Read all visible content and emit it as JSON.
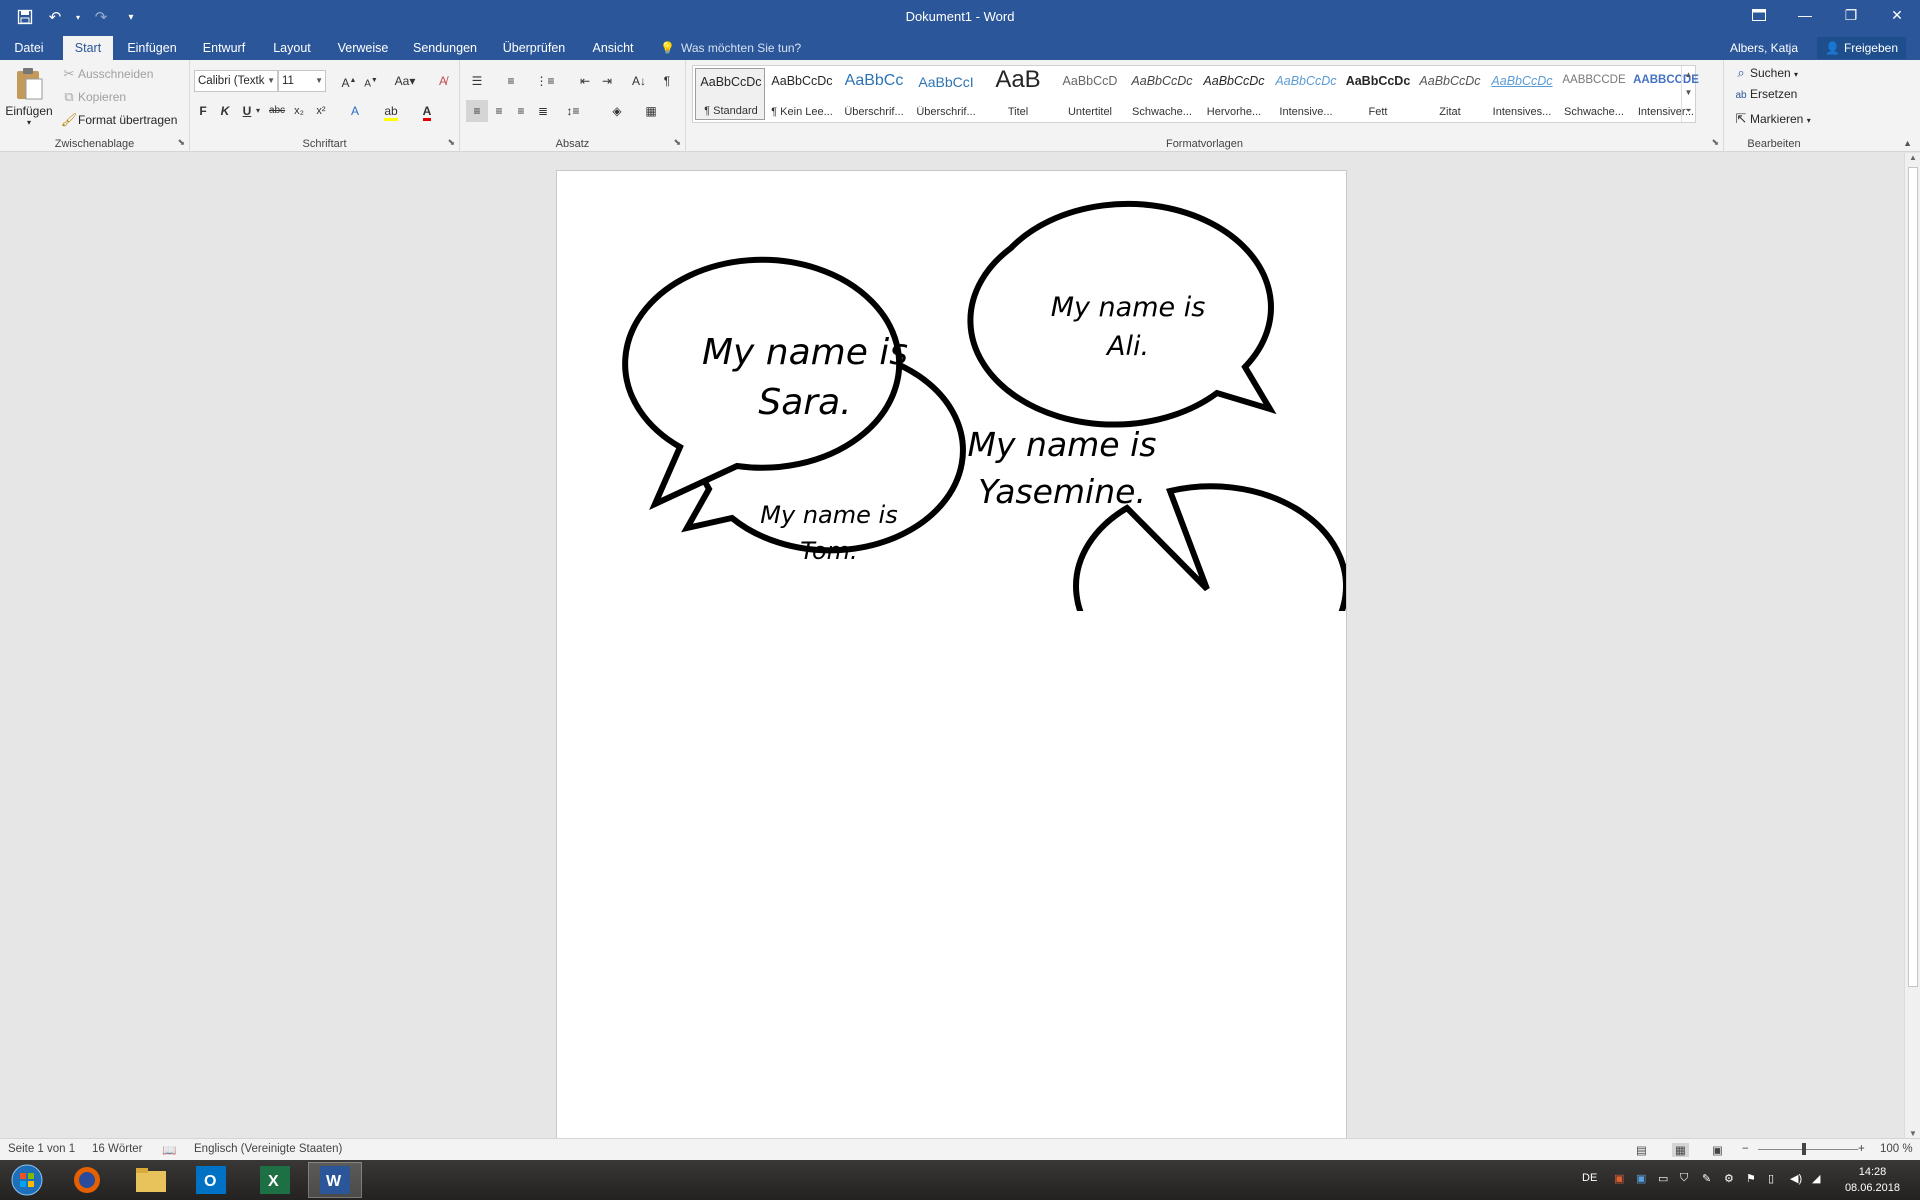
{
  "window": {
    "title": "Dokument1 - Word",
    "quick_access": [
      "save-icon",
      "undo-icon",
      "redo-icon",
      "customize-icon"
    ]
  },
  "tabs": [
    {
      "label": "Datei"
    },
    {
      "label": "Start"
    },
    {
      "label": "Einfügen"
    },
    {
      "label": "Entwurf"
    },
    {
      "label": "Layout"
    },
    {
      "label": "Verweise"
    },
    {
      "label": "Sendungen"
    },
    {
      "label": "Überprüfen"
    },
    {
      "label": "Ansicht"
    }
  ],
  "active_tab": "Start",
  "tell_me": "Was möchten Sie tun?",
  "user": "Albers, Katja",
  "share": "Freigeben",
  "clipboard": {
    "paste": "Einfügen",
    "cut": "Ausschneiden",
    "copy": "Kopieren",
    "format_painter": "Format übertragen",
    "label": "Zwischenablage"
  },
  "font": {
    "family": "Calibri (Textk",
    "size": "11",
    "bold": "F",
    "italic": "K",
    "underline": "U",
    "label": "Schriftart"
  },
  "paragraph": {
    "label": "Absatz"
  },
  "styles": {
    "label": "Formatvorlagen",
    "items": [
      {
        "sample": "AaBbCcDc",
        "name": "¶ Standard"
      },
      {
        "sample": "AaBbCcDc",
        "name": "¶ Kein Lee..."
      },
      {
        "sample": "AaBbCc",
        "name": "Überschrif..."
      },
      {
        "sample": "AaBbCcI",
        "name": "Überschrif..."
      },
      {
        "sample": "AaB",
        "name": "Titel"
      },
      {
        "sample": "AaBbCcD",
        "name": "Untertitel"
      },
      {
        "sample": "AaBbCcDc",
        "name": "Schwache..."
      },
      {
        "sample": "AaBbCcDc",
        "name": "Hervorhe..."
      },
      {
        "sample": "AaBbCcDc",
        "name": "Intensive..."
      },
      {
        "sample": "AaBbCcDc",
        "name": "Fett"
      },
      {
        "sample": "AaBbCcDc",
        "name": "Zitat"
      },
      {
        "sample": "AaBbCcDc",
        "name": "Intensives..."
      },
      {
        "sample": "AABBCCDE",
        "name": "Schwache..."
      },
      {
        "sample": "AABBCCDE",
        "name": "Intensiver..."
      }
    ]
  },
  "editing": {
    "find": "Suchen",
    "replace": "Ersetzen",
    "select": "Markieren",
    "label": "Bearbeiten"
  },
  "document": {
    "bubbles": [
      {
        "line1": "My name is",
        "line2": "Sara."
      },
      {
        "line1": "My name is",
        "line2": "Ali."
      },
      {
        "line1": "My name is",
        "line2": "Tom."
      },
      {
        "line1": "My name is",
        "line2": "Yasemine."
      }
    ]
  },
  "status": {
    "page": "Seite 1 von 1",
    "words": "16 Wörter",
    "language": "Englisch (Vereinigte Staaten)",
    "zoom": "100 %"
  },
  "taskbar": {
    "lang": "DE",
    "time": "14:28",
    "date": "08.06.2018"
  },
  "colors": {
    "accent": "#2b579a",
    "ribbon_bg": "#f3f3f3",
    "workspace": "#e6e6e6"
  }
}
